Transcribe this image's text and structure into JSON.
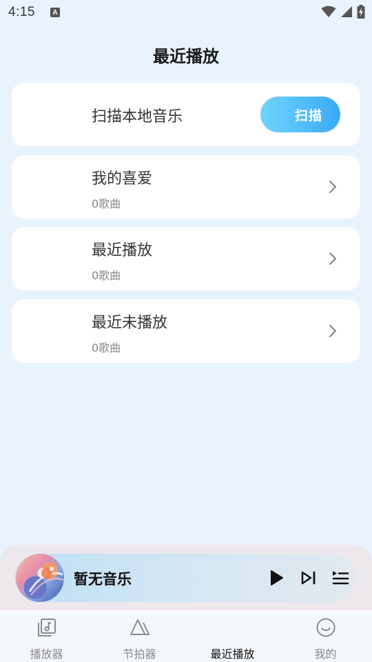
{
  "status_bar": {
    "time": "4:15",
    "notification_letter": "A"
  },
  "header": {
    "title": "最近播放"
  },
  "scan": {
    "label": "扫描本地音乐",
    "button_label": "扫描"
  },
  "lists": [
    {
      "title": "我的喜爱",
      "count": "0歌曲"
    },
    {
      "title": "最近播放",
      "count": "0歌曲"
    },
    {
      "title": "最近未播放",
      "count": "0歌曲"
    }
  ],
  "mini_player": {
    "title": "暂无音乐",
    "icons": [
      "play-icon",
      "skip-next-icon",
      "playlist-icon"
    ]
  },
  "tabs": [
    {
      "label": "播放器",
      "icon": "music-library-icon"
    },
    {
      "label": "节拍器",
      "icon": "metronome-icon"
    },
    {
      "label": "最近播放",
      "icon": ""
    },
    {
      "label": "我的",
      "icon": "smiley-face-icon"
    }
  ],
  "colors": {
    "background": "#e9f3fd",
    "accent_start": "#6fd4fb",
    "accent_end": "#3aaaf7"
  }
}
